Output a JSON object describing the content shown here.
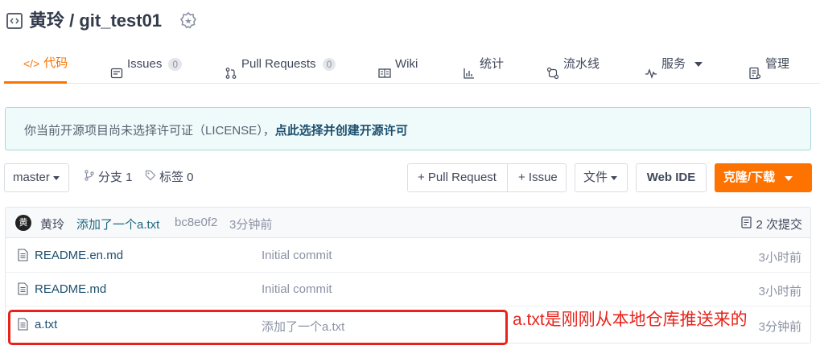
{
  "header": {
    "title": "黄玲 / git_test01"
  },
  "tabs": [
    {
      "label": "代码",
      "icon": "code-icon"
    },
    {
      "label": "Issues",
      "count": "0",
      "icon": "issues-icon"
    },
    {
      "label": "Pull Requests",
      "count": "0",
      "icon": "pull-request-icon"
    },
    {
      "label": "Wiki",
      "icon": "wiki-icon"
    },
    {
      "label": "统计",
      "icon": "chart-icon"
    },
    {
      "label": "流水线",
      "icon": "pipeline-icon"
    },
    {
      "label": "服务",
      "icon": "service-icon"
    },
    {
      "label": "管理",
      "icon": "manage-icon"
    }
  ],
  "notice": {
    "text": "你当前开源项目尚未选择许可证（LICENSE），",
    "link": "点此选择并创建开源许可"
  },
  "toolbar": {
    "branch": "master",
    "branches": "分支 1",
    "tags": "标签 0",
    "pull_request": "+ Pull Request",
    "issue": "+ Issue",
    "file": "文件",
    "web_ide": "Web IDE",
    "clone": "克隆/下载"
  },
  "commit": {
    "avatar": "黄",
    "author": "黄玲",
    "message": "添加了一个a.txt",
    "hash": "bc8e0f2",
    "time": "3分钟前",
    "count": "2 次提交"
  },
  "files": [
    {
      "name": "README.en.md",
      "message": "Initial commit",
      "time": "3小时前"
    },
    {
      "name": "README.md",
      "message": "Initial commit",
      "time": "3小时前"
    },
    {
      "name": "a.txt",
      "message": "添加了一个a.txt",
      "time": "3分钟前"
    }
  ],
  "annotation": {
    "text": "a.txt是刚刚从本地仓库推送来的",
    "color": "#e8231b"
  },
  "colors": {
    "accent": "#fe7300",
    "link": "#1d4f6e",
    "notice_bg": "#effafb"
  }
}
